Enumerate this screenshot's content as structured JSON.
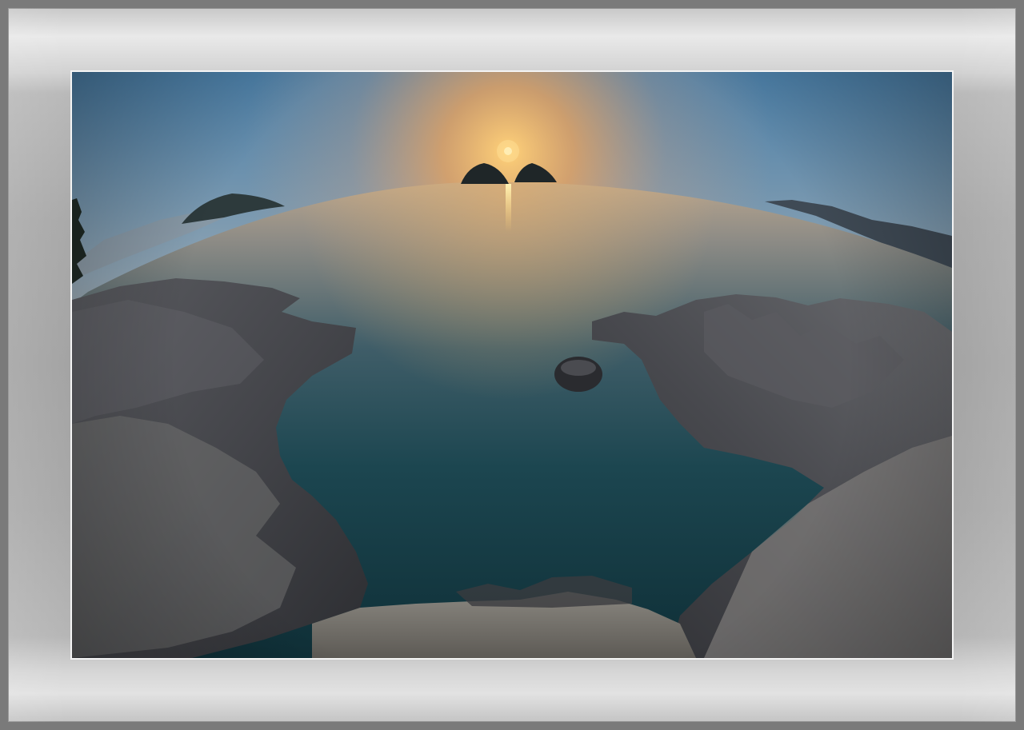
{
  "scene": {
    "subject": "",
    "colors": {
      "mat_light": "#e9e9e9",
      "mat_dark": "#a4a4a4",
      "sky_top": "#3d6f9a",
      "sky_glow": "#f3a85a",
      "sun": "#fff6c8",
      "water_deep": "#123a44",
      "rock": "#3f4044"
    }
  }
}
